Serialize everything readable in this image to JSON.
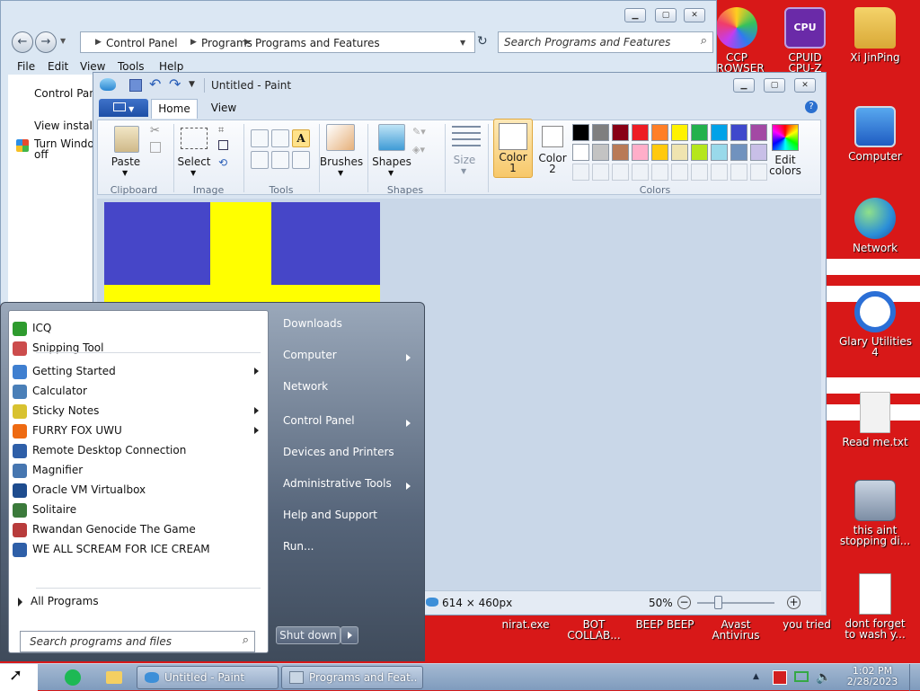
{
  "desktop": {
    "icons": [
      {
        "label": "CCP\nBROWSER"
      },
      {
        "label": "CPUID\nCPU-Z"
      },
      {
        "label": "Xi JinPing"
      },
      {
        "label": "Computer"
      },
      {
        "label": "Network"
      },
      {
        "label": "Glary Utilities\n4"
      },
      {
        "label": "Read me.txt"
      },
      {
        "label": "this aint\nstopping di..."
      },
      {
        "label": "dont forget\nto wash y..."
      }
    ],
    "bottom_labels": [
      "nirat.exe",
      "BOT\nCOLLAB...",
      "BEEP BEEP",
      "Avast\nAntivirus",
      "you tried"
    ],
    "colors": {
      "background": "#d81818",
      "stripe": "#ffffff"
    }
  },
  "explorer": {
    "breadcrumb": [
      "Control Panel",
      "Programs",
      "Programs and Features"
    ],
    "search_placeholder": "Search Programs and Features",
    "menu": [
      "File",
      "Edit",
      "View",
      "Tools",
      "Help"
    ],
    "sidebar": [
      "Control Panel",
      "View installe",
      "Turn Window",
      "off"
    ]
  },
  "paint": {
    "title": "Untitled - Paint",
    "file_tab": "",
    "tabs": [
      "Home",
      "View"
    ],
    "groups": {
      "clipboard": "Clipboard",
      "image": "Image",
      "tools": "Tools",
      "shapes": "Shapes",
      "colors": "Colors"
    },
    "buttons": {
      "paste": "Paste",
      "select": "Select",
      "brushes": "Brushes",
      "shapes": "Shapes",
      "size": "Size",
      "color1_a": "Color",
      "color1_b": "1",
      "color2_a": "Color",
      "color2_b": "2",
      "edit_colors_a": "Edit",
      "edit_colors_b": "colors"
    },
    "palette_row1": [
      "#000000",
      "#7f7f7f",
      "#880015",
      "#ed1c24",
      "#ff7f27",
      "#fff200",
      "#22b14c",
      "#00a2e8",
      "#3f48cc",
      "#a349a4"
    ],
    "palette_row2": [
      "#ffffff",
      "#c3c3c3",
      "#b97a57",
      "#ffaec9",
      "#ffc90e",
      "#efe4b0",
      "#b5e61d",
      "#99d9ea",
      "#7092be",
      "#c8bfe7"
    ],
    "canvas": {
      "blue": "#4646c8",
      "yellow": "#ffff00"
    },
    "status": {
      "size": "614 × 460px",
      "zoom": "50%"
    }
  },
  "start_menu": {
    "programs": [
      {
        "label": "ICQ",
        "color": "#2e9b2e",
        "submenu": false
      },
      {
        "label": "Snipping Tool",
        "color": "#cc4c4c",
        "submenu": false
      },
      {
        "label": "Getting Started",
        "color": "#3f7fd0",
        "submenu": true
      },
      {
        "label": "Calculator",
        "color": "#4a7fb8",
        "submenu": false
      },
      {
        "label": "Sticky Notes",
        "color": "#d8c230",
        "submenu": true
      },
      {
        "label": "FURRY FOX UWU",
        "color": "#ee6a12",
        "submenu": true
      },
      {
        "label": "Remote Desktop Connection",
        "color": "#2e5fa8",
        "submenu": false
      },
      {
        "label": "Magnifier",
        "color": "#4676b0",
        "submenu": false
      },
      {
        "label": "Oracle VM Virtualbox",
        "color": "#1e4c8e",
        "submenu": false
      },
      {
        "label": "Solitaire",
        "color": "#3b7a3b",
        "submenu": false
      },
      {
        "label": "Rwandan Genocide The Game",
        "color": "#b83c3c",
        "submenu": false
      },
      {
        "label": "WE ALL SCREAM FOR ICE CREAM",
        "color": "#2e5fa8",
        "submenu": false
      }
    ],
    "all_programs": "All Programs",
    "search_placeholder": "Search programs and files",
    "right_items": [
      {
        "label": "Downloads",
        "submenu": false
      },
      {
        "label": "Computer",
        "submenu": true
      },
      {
        "label": "Network",
        "submenu": false
      },
      {
        "label": "Control Panel",
        "submenu": true
      },
      {
        "label": "Devices and Printers",
        "submenu": false
      },
      {
        "label": "Administrative Tools",
        "submenu": true
      },
      {
        "label": "Help and Support",
        "submenu": false
      },
      {
        "label": "Run...",
        "submenu": false
      }
    ],
    "shutdown": "Shut down"
  },
  "taskbar": {
    "windows": [
      "Untitled - Paint",
      "Programs and Feat..."
    ],
    "time": "1:02 PM",
    "date": "2/28/2023"
  }
}
